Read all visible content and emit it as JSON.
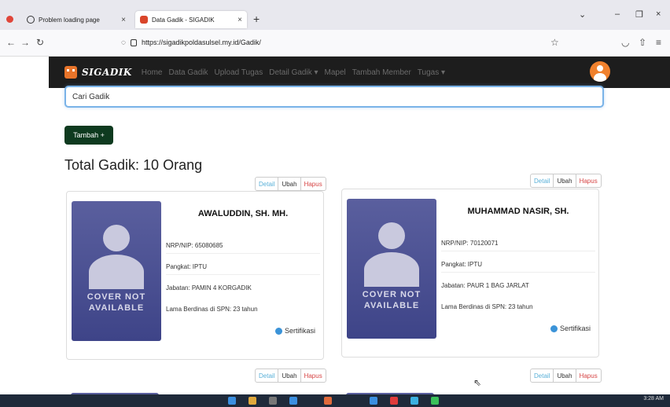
{
  "browser": {
    "tabs": [
      {
        "label": "Problem loading page"
      },
      {
        "label": "Data Gadik - SIGADIK"
      }
    ],
    "url": "https://sigadikpoldasulsel.my.id/Gadik/"
  },
  "site": {
    "brand": "SIGADIK",
    "menu": [
      "Home",
      "Data Gadik",
      "Upload Tugas",
      "Detail Gadik ▾",
      "Mapel",
      "Tambah Member",
      "Tugas ▾"
    ],
    "search_placeholder": "Cari Gadik",
    "add_button": "Tambah +",
    "total": "Total Gadik: 10 Orang",
    "actions": {
      "detail": "Detail",
      "ubah": "Ubah",
      "hapus": "Hapus"
    },
    "cover_text": "COVER NOT AVAILABLE",
    "cards": [
      {
        "name": "AWALUDDIN, SH. MH.",
        "nrp": "NRP/NIP: 65080685",
        "pangkat": "Pangkat: IPTU",
        "jabatan": "Jabatan: PAMIN 4 KORGADIK",
        "lama": "Lama Berdinas di SPN: 23 tahun",
        "cert": "Sertifikasi"
      },
      {
        "name": "MUHAMMAD NASIR, SH.",
        "nrp": "NRP/NIP: 70120071",
        "pangkat": "Pangkat: IPTU",
        "jabatan": "Jabatan: PAUR 1 BAG JARLAT",
        "lama": "Lama Berdinas di SPN: 23 tahun",
        "cert": "Sertifikasi"
      }
    ]
  },
  "taskbar": {
    "time": "3:28 AM"
  },
  "colors": {
    "nav_bg": "#1d1d1d",
    "accent": "#e8742a",
    "add_button": "#0e3a1f",
    "cover": "#4a4f92",
    "hapus": "#d64545",
    "detail": "#5ab0d8"
  }
}
